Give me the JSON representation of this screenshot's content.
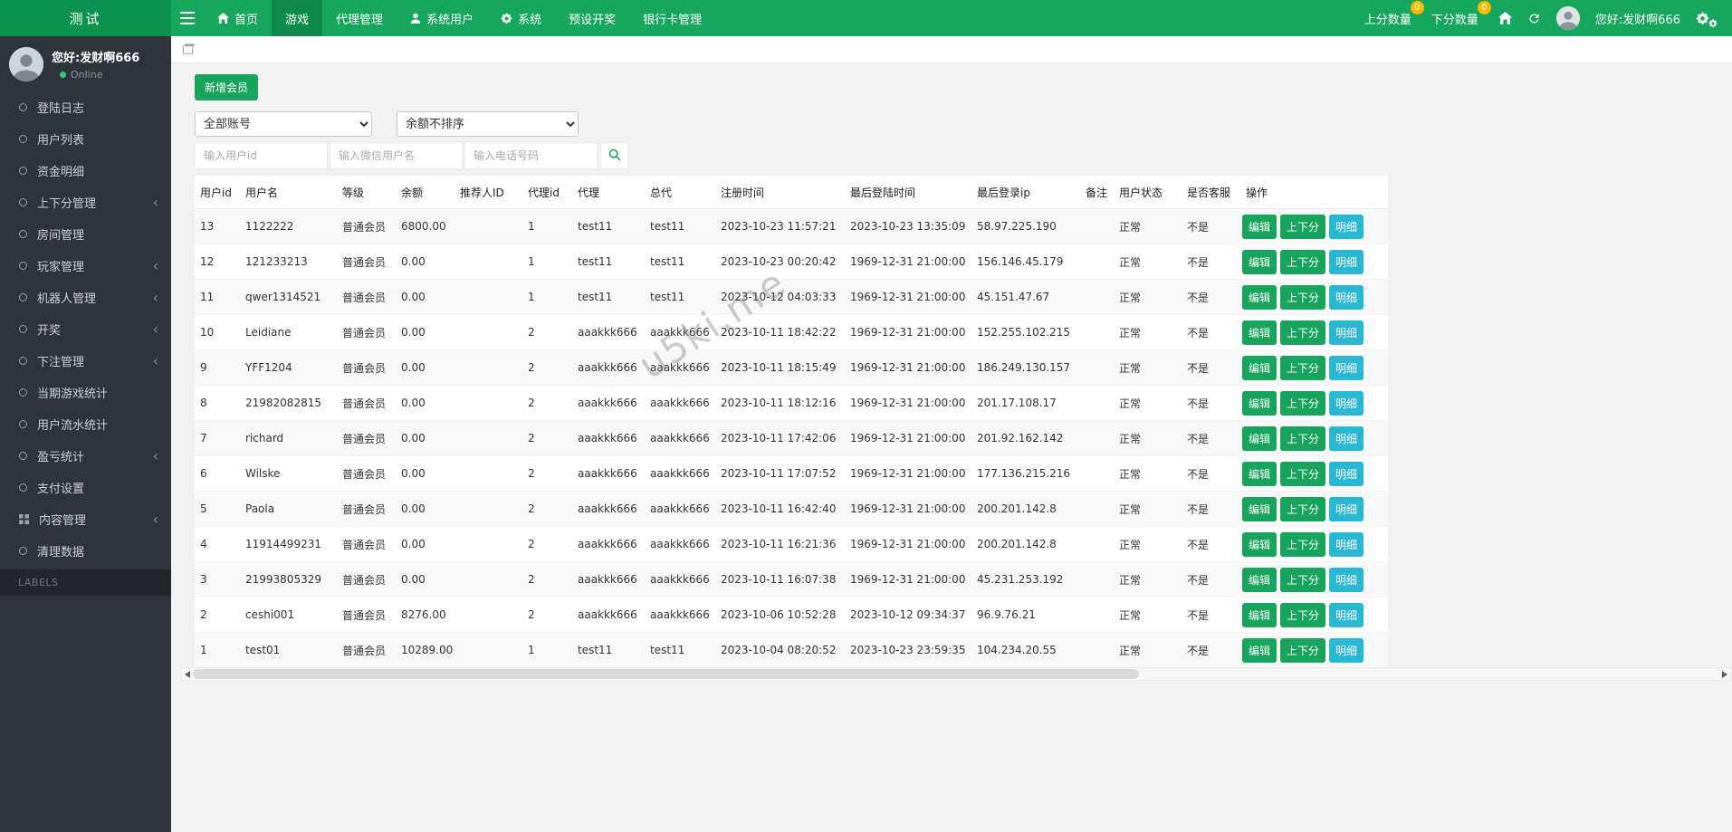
{
  "brand": {
    "title": "测试"
  },
  "navbar": {
    "items": [
      {
        "id": "home",
        "label": "首页",
        "icon": "home"
      },
      {
        "id": "games",
        "label": "游戏",
        "active": true
      },
      {
        "id": "agent-management",
        "label": "代理管理"
      },
      {
        "id": "system-users",
        "label": "系统用户",
        "icon": "user"
      },
      {
        "id": "system",
        "label": "系统",
        "icon": "gear"
      },
      {
        "id": "preset-draw",
        "label": "预设开奖"
      },
      {
        "id": "bank-card-management",
        "label": "银行卡管理"
      }
    ],
    "right": {
      "up_score": {
        "label": "上分数量",
        "badge": "0"
      },
      "down_score": {
        "label": "下分数量",
        "badge": "0"
      },
      "greeting": "您好:发财啊666"
    }
  },
  "sidebar": {
    "greeting": "您好:发财啊666",
    "status": "Online",
    "items": [
      {
        "id": "login-logs",
        "label": "登陆日志"
      },
      {
        "id": "user-list",
        "label": "用户列表"
      },
      {
        "id": "funds-detail",
        "label": "资金明细"
      },
      {
        "id": "updown-score-management",
        "label": "上下分管理",
        "expandable": true
      },
      {
        "id": "room-management",
        "label": "房间管理"
      },
      {
        "id": "player-management",
        "label": "玩家管理",
        "expandable": true
      },
      {
        "id": "robot-management",
        "label": "机器人管理",
        "expandable": true
      },
      {
        "id": "lottery-draw",
        "label": "开奖",
        "expandable": true
      },
      {
        "id": "bet-management",
        "label": "下注管理",
        "expandable": true
      },
      {
        "id": "current-game-stats",
        "label": "当期游戏统计"
      },
      {
        "id": "user-turnover-stats",
        "label": "用户流水统计"
      },
      {
        "id": "profit-loss-stats",
        "label": "盈亏统计",
        "expandable": true
      },
      {
        "id": "payment-settings",
        "label": "支付设置"
      },
      {
        "id": "content-management",
        "label": "内容管理",
        "expandable": true,
        "icon": "grid"
      },
      {
        "id": "clear-data",
        "label": "清理数据"
      }
    ],
    "section_label": "LABELS"
  },
  "toolbar": {
    "add_member_label": "新增会员",
    "filters": [
      {
        "value": "全部账号"
      },
      {
        "value": "余额不排序"
      }
    ],
    "inputs": [
      {
        "placeholder": "输入用户id"
      },
      {
        "placeholder": "输入微信用户名"
      },
      {
        "placeholder": "输入电话号码"
      }
    ]
  },
  "table": {
    "headers": [
      "用户id",
      "用户名",
      "等级",
      "余额",
      "推荐人ID",
      "代理id",
      "代理",
      "总代",
      "注册时间",
      "最后登陆时间",
      "最后登录ip",
      "备注",
      "用户状态",
      "是否客服",
      "操作"
    ],
    "actions": [
      "编辑",
      "上下分",
      "明细"
    ],
    "rows": [
      [
        "13",
        "1122222",
        "普通会员",
        "6800.00",
        "",
        "1",
        "test11",
        "test11",
        "2023-10-23 11:57:21",
        "2023-10-23 13:35:09",
        "58.97.225.190",
        "",
        "正常",
        "不是"
      ],
      [
        "12",
        "121233213",
        "普通会员",
        "0.00",
        "",
        "1",
        "test11",
        "test11",
        "2023-10-23 00:20:42",
        "1969-12-31 21:00:00",
        "156.146.45.179",
        "",
        "正常",
        "不是"
      ],
      [
        "11",
        "qwer1314521",
        "普通会员",
        "0.00",
        "",
        "1",
        "test11",
        "test11",
        "2023-10-12 04:03:33",
        "1969-12-31 21:00:00",
        "45.151.47.67",
        "",
        "正常",
        "不是"
      ],
      [
        "10",
        "Leidiane",
        "普通会员",
        "0.00",
        "",
        "2",
        "aaakkk666",
        "aaakkk666",
        "2023-10-11 18:42:22",
        "1969-12-31 21:00:00",
        "152.255.102.215",
        "",
        "正常",
        "不是"
      ],
      [
        "9",
        "YFF1204",
        "普通会员",
        "0.00",
        "",
        "2",
        "aaakkk666",
        "aaakkk666",
        "2023-10-11 18:15:49",
        "1969-12-31 21:00:00",
        "186.249.130.157",
        "",
        "正常",
        "不是"
      ],
      [
        "8",
        "21982082815",
        "普通会员",
        "0.00",
        "",
        "2",
        "aaakkk666",
        "aaakkk666",
        "2023-10-11 18:12:16",
        "1969-12-31 21:00:00",
        "201.17.108.17",
        "",
        "正常",
        "不是"
      ],
      [
        "7",
        "richard",
        "普通会员",
        "0.00",
        "",
        "2",
        "aaakkk666",
        "aaakkk666",
        "2023-10-11 17:42:06",
        "1969-12-31 21:00:00",
        "201.92.162.142",
        "",
        "正常",
        "不是"
      ],
      [
        "6",
        "Wilske",
        "普通会员",
        "0.00",
        "",
        "2",
        "aaakkk666",
        "aaakkk666",
        "2023-10-11 17:07:52",
        "1969-12-31 21:00:00",
        "177.136.215.216",
        "",
        "正常",
        "不是"
      ],
      [
        "5",
        "Paola",
        "普通会员",
        "0.00",
        "",
        "2",
        "aaakkk666",
        "aaakkk666",
        "2023-10-11 16:42:40",
        "1969-12-31 21:00:00",
        "200.201.142.8",
        "",
        "正常",
        "不是"
      ],
      [
        "4",
        "11914499231",
        "普通会员",
        "0.00",
        "",
        "2",
        "aaakkk666",
        "aaakkk666",
        "2023-10-11 16:21:36",
        "1969-12-31 21:00:00",
        "200.201.142.8",
        "",
        "正常",
        "不是"
      ],
      [
        "3",
        "21993805329",
        "普通会员",
        "0.00",
        "",
        "2",
        "aaakkk666",
        "aaakkk666",
        "2023-10-11 16:07:38",
        "1969-12-31 21:00:00",
        "45.231.253.192",
        "",
        "正常",
        "不是"
      ],
      [
        "2",
        "ceshi001",
        "普通会员",
        "8276.00",
        "",
        "2",
        "aaakkk666",
        "aaakkk666",
        "2023-10-06 10:52:28",
        "2023-10-12 09:34:37",
        "96.9.76.21",
        "",
        "正常",
        "不是"
      ],
      [
        "1",
        "test01",
        "普通会员",
        "10289.00",
        "",
        "1",
        "test11",
        "test11",
        "2023-10-04 08:20:52",
        "2023-10-23 23:59:35",
        "104.234.20.55",
        "",
        "正常",
        "不是"
      ]
    ]
  },
  "watermark": "u5ki.me",
  "colors": {
    "navbar_green": "#16a75c",
    "brand_green": "#0d9350",
    "active_nav_green": "#0d8a49",
    "badge_orange": "#ffb800",
    "sidebar_dark": "#2f343a",
    "action_green": "#18a45c",
    "action_cyan": "#29b7d3",
    "online_green": "#2ecc71"
  }
}
